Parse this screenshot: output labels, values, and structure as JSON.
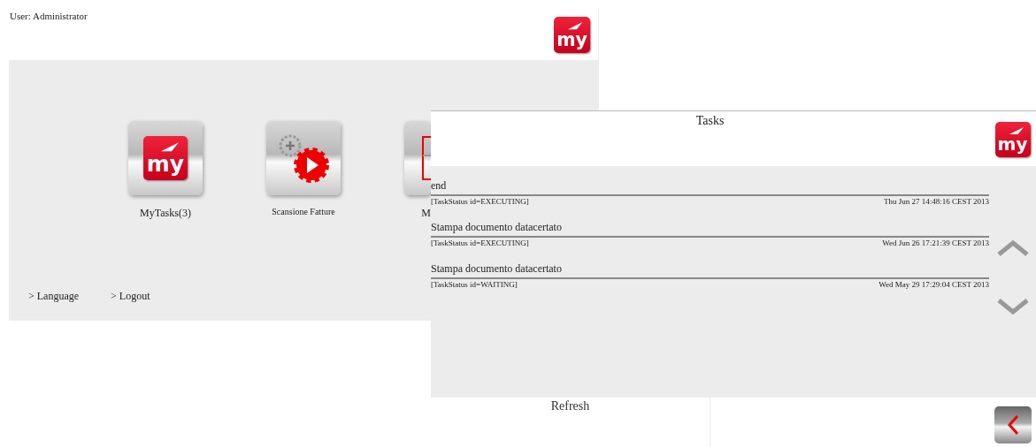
{
  "home_window": {
    "user_label": "User: Administrator",
    "logo": "my",
    "tiles": [
      {
        "kind": "logo",
        "logo": "my",
        "label": "MyTasks(3)"
      },
      {
        "kind": "gears",
        "label": "Scansione Fatture"
      },
      {
        "kind": "document",
        "label": "M"
      }
    ],
    "links": [
      "> Language",
      "> Logout"
    ]
  },
  "tasks_window": {
    "title": "Tasks",
    "logo": "my",
    "tasks": [
      {
        "name": "end",
        "status": "[TaskStatus id=EXECUTING]",
        "date": "Thu Jun 27 14:48:16 CEST 2013"
      },
      {
        "name": "Stampa documento datacertato",
        "status": "[TaskStatus id=EXECUTING]",
        "date": "Wed Jun 26 17:21:39 CEST 2013"
      },
      {
        "name": "Stampa documento datacertato",
        "status": "[TaskStatus id=WAITING]",
        "date": "Wed May 29 17:29:04 CEST 2013"
      }
    ],
    "footer": {
      "refresh": "Refresh"
    }
  }
}
